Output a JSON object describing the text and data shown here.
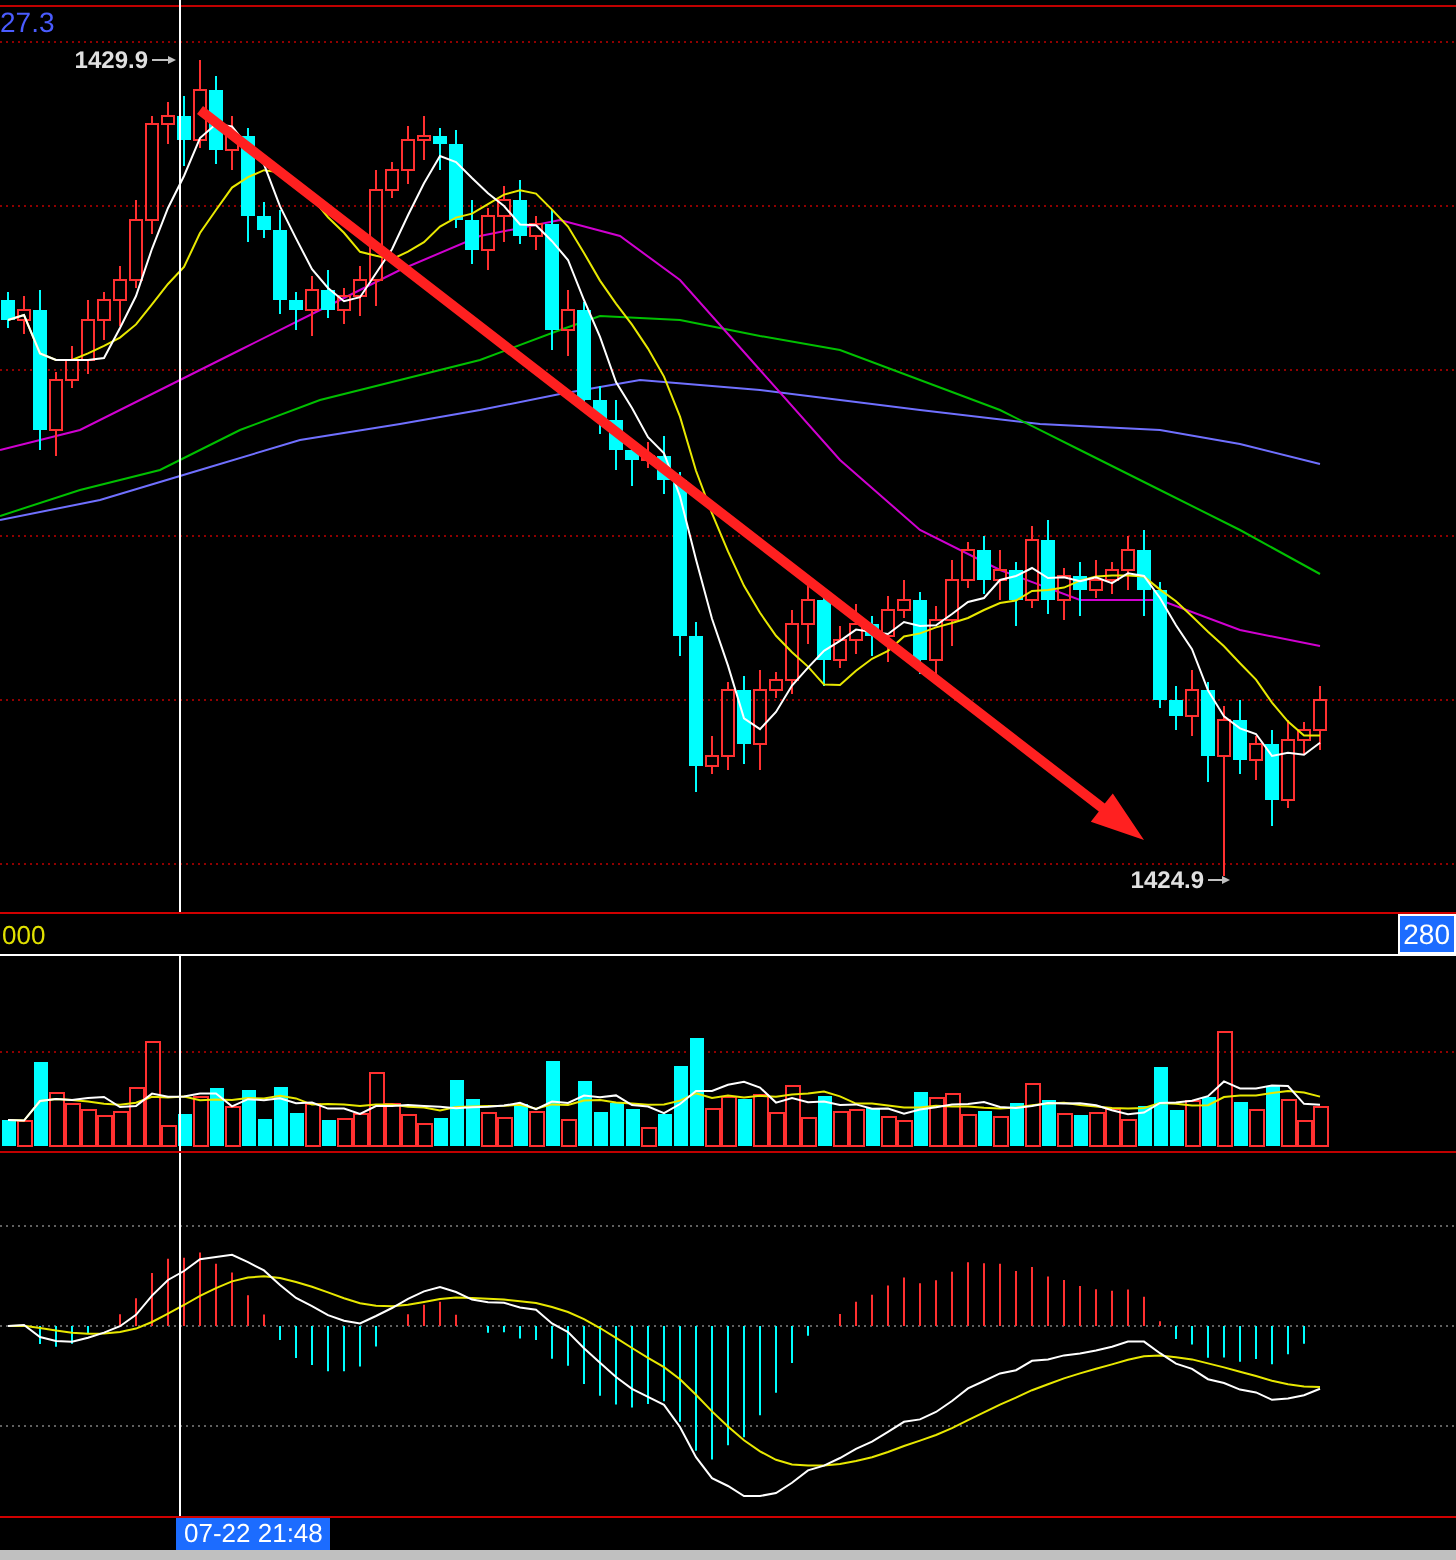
{
  "price_panel": {
    "axis_label": "27.3",
    "high_marker": "1429.9",
    "low_marker": "1424.9"
  },
  "volume_panel": {
    "left_label": "000",
    "right_label": "280"
  },
  "crosshair": {
    "time_label": "07-22 21:48"
  }
}
